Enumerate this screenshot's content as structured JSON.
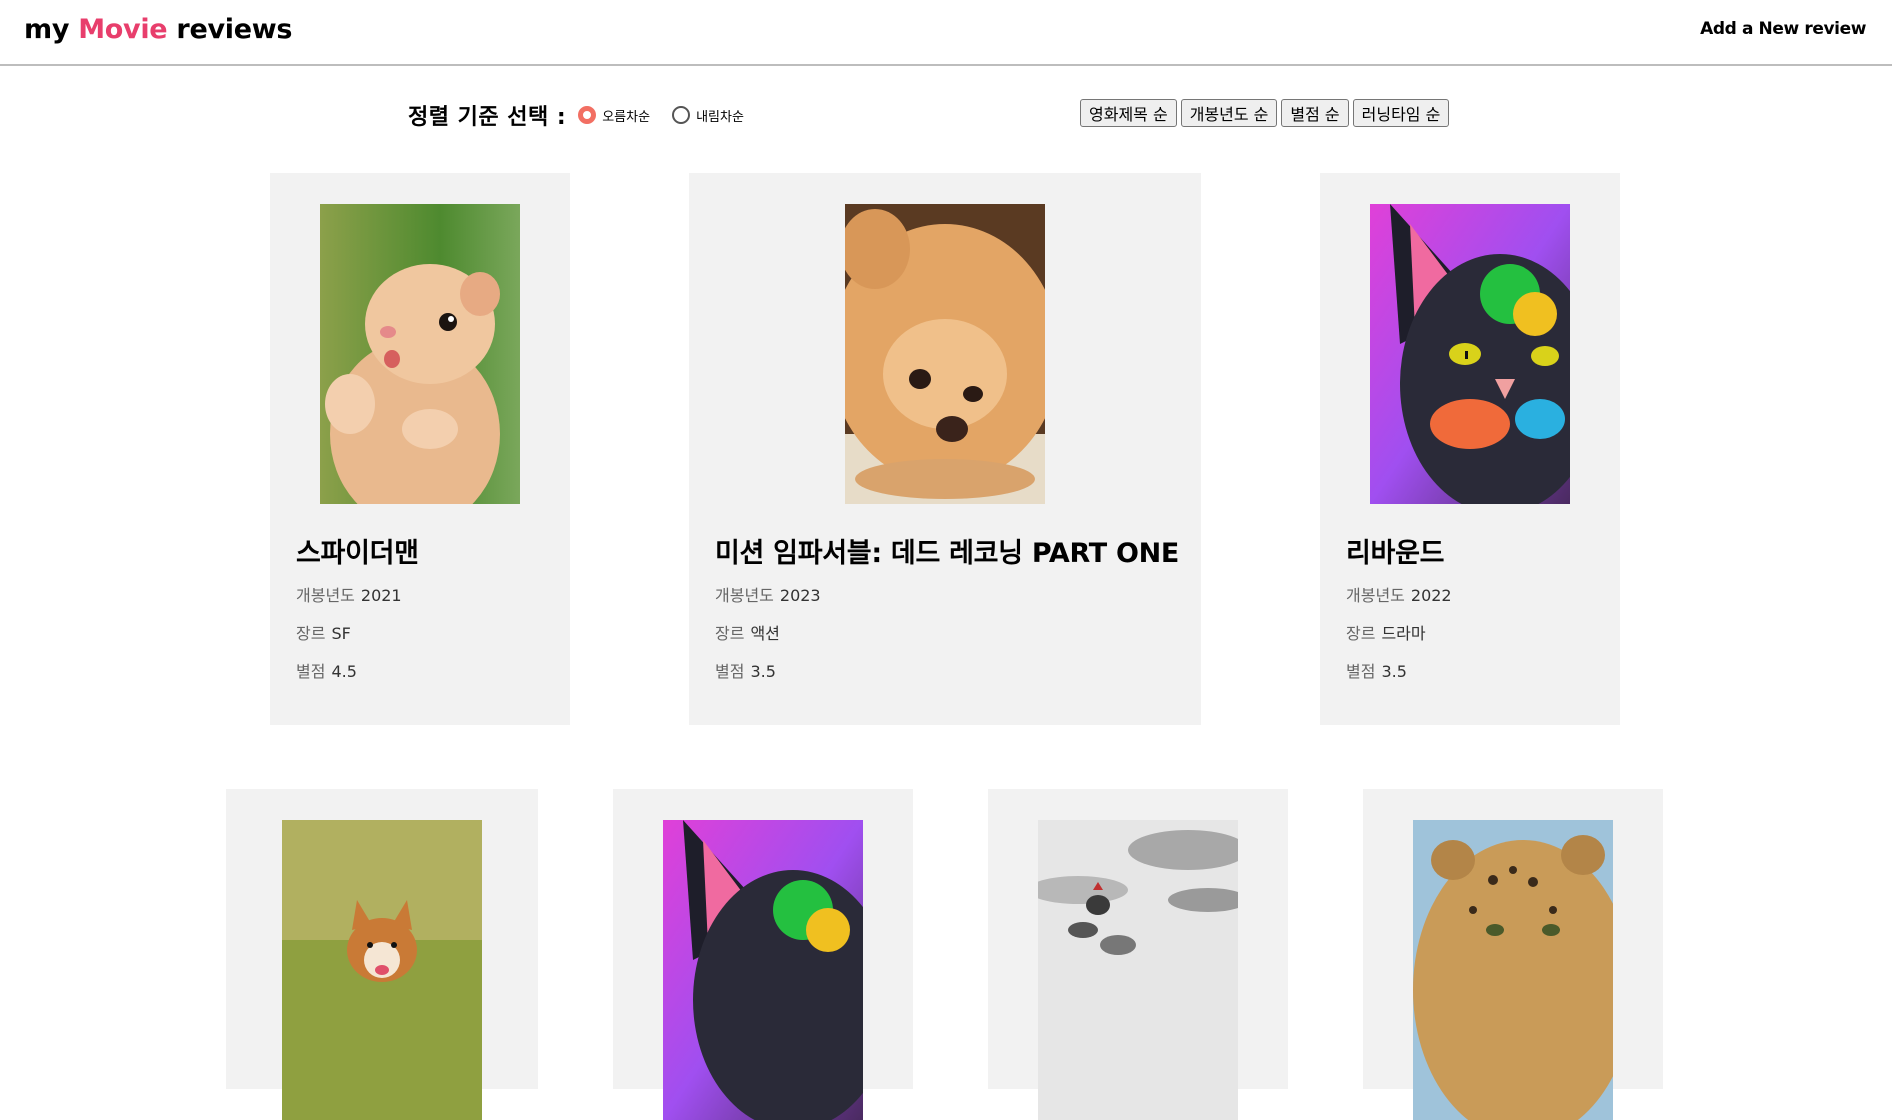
{
  "header": {
    "logo_prefix": "my ",
    "logo_accent": "Movie",
    "logo_suffix": " reviews",
    "accent_color": "#e83e6c",
    "add_link": "Add a New review"
  },
  "sort": {
    "title": "정렬 기준 선택 :",
    "order_options": [
      {
        "label": "오름차순",
        "checked": true
      },
      {
        "label": "내림차순",
        "checked": false
      }
    ],
    "buttons": [
      "영화제목 순",
      "개봉년도 순",
      "별점 순",
      "러닝타임 순"
    ]
  },
  "labels": {
    "year": "개봉년도",
    "genre": "장르",
    "rating": "별점"
  },
  "movies": [
    {
      "title": "스파이더맨",
      "year": "2021",
      "genre": "SF",
      "rating": "4.5",
      "poster": "hamster"
    },
    {
      "title": "미션 임파서블: 데드 레코닝 PART ONE",
      "year": "2023",
      "genre": "액션",
      "rating": "3.5",
      "poster": "pomeranian"
    },
    {
      "title": "리바운드",
      "year": "2022",
      "genre": "드라마",
      "rating": "3.5",
      "poster": "colorful-cat"
    },
    {
      "poster": "corgi"
    },
    {
      "poster": "colorful-cat"
    },
    {
      "poster": "animals-stack"
    },
    {
      "poster": "leopard"
    }
  ]
}
